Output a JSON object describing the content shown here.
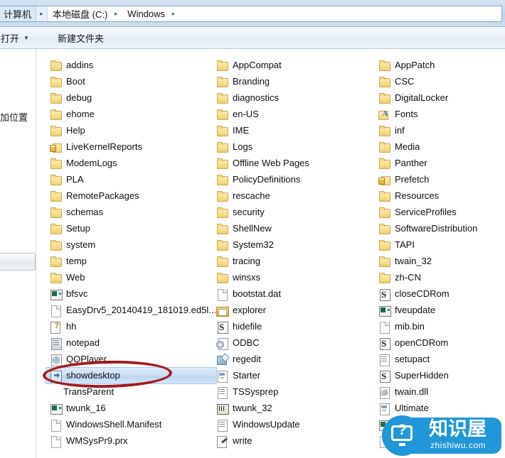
{
  "window": {
    "title": "Windows",
    "breadcrumb": {
      "root": "计算机",
      "items": [
        "本地磁盘 (C:)",
        "Windows"
      ],
      "separator": "▸",
      "root_arrow": "▸"
    }
  },
  "toolbar": {
    "open_label": "打开",
    "open_caret": "▼",
    "new_folder_label": "新建文件夹"
  },
  "nav_pane": {
    "clipped_label": "加位置"
  },
  "file_list": {
    "columns": [
      {
        "name": "column-1",
        "items": [
          {
            "label": "addins",
            "icon": "folder"
          },
          {
            "label": "Boot",
            "icon": "folder"
          },
          {
            "label": "debug",
            "icon": "folder"
          },
          {
            "label": "ehome",
            "icon": "folder"
          },
          {
            "label": "Help",
            "icon": "folder"
          },
          {
            "label": "LiveKernelReports",
            "icon": "folder-lock"
          },
          {
            "label": "ModemLogs",
            "icon": "folder"
          },
          {
            "label": "PLA",
            "icon": "folder"
          },
          {
            "label": "RemotePackages",
            "icon": "folder"
          },
          {
            "label": "schemas",
            "icon": "folder"
          },
          {
            "label": "Setup",
            "icon": "folder"
          },
          {
            "label": "system",
            "icon": "folder"
          },
          {
            "label": "temp",
            "icon": "folder"
          },
          {
            "label": "Web",
            "icon": "folder"
          },
          {
            "label": "bfsvc",
            "icon": "exe"
          },
          {
            "label": "EasyDrv5_20140419_181019.ed5l...",
            "icon": "doc"
          },
          {
            "label": "hh",
            "icon": "help"
          },
          {
            "label": "notepad",
            "icon": "notepad"
          },
          {
            "label": "QQPlayer",
            "icon": "media"
          },
          {
            "label": "showdesktop",
            "icon": "showdesktop",
            "selected": true
          },
          {
            "label": "TransParent",
            "icon": "none"
          },
          {
            "label": "twunk_16",
            "icon": "exe"
          },
          {
            "label": "WindowsShell.Manifest",
            "icon": "doc"
          },
          {
            "label": "WMSysPr9.prx",
            "icon": "doc"
          }
        ]
      },
      {
        "name": "column-2",
        "items": [
          {
            "label": "AppCompat",
            "icon": "folder"
          },
          {
            "label": "Branding",
            "icon": "folder"
          },
          {
            "label": "diagnostics",
            "icon": "folder"
          },
          {
            "label": "en-US",
            "icon": "folder"
          },
          {
            "label": "IME",
            "icon": "folder"
          },
          {
            "label": "Logs",
            "icon": "folder"
          },
          {
            "label": "Offline Web Pages",
            "icon": "folder"
          },
          {
            "label": "PolicyDefinitions",
            "icon": "folder"
          },
          {
            "label": "rescache",
            "icon": "folder"
          },
          {
            "label": "security",
            "icon": "folder"
          },
          {
            "label": "ShellNew",
            "icon": "folder"
          },
          {
            "label": "System32",
            "icon": "folder"
          },
          {
            "label": "tracing",
            "icon": "folder"
          },
          {
            "label": "winsxs",
            "icon": "folder"
          },
          {
            "label": "bootstat.dat",
            "icon": "doc"
          },
          {
            "label": "explorer",
            "icon": "explorer"
          },
          {
            "label": "hidefile",
            "icon": "script"
          },
          {
            "label": "ODBC",
            "icon": "cfg"
          },
          {
            "label": "regedit",
            "icon": "reg"
          },
          {
            "label": "Starter",
            "icon": "ini"
          },
          {
            "label": "TSSysprep",
            "icon": "text"
          },
          {
            "label": "twunk_32",
            "icon": "app"
          },
          {
            "label": "WindowsUpdate",
            "icon": "text"
          },
          {
            "label": "write",
            "icon": "write"
          }
        ]
      },
      {
        "name": "column-3",
        "items": [
          {
            "label": "AppPatch",
            "icon": "folder"
          },
          {
            "label": "CSC",
            "icon": "folder"
          },
          {
            "label": "DigitalLocker",
            "icon": "folder"
          },
          {
            "label": "Fonts",
            "icon": "folder-a"
          },
          {
            "label": "inf",
            "icon": "folder"
          },
          {
            "label": "Media",
            "icon": "folder"
          },
          {
            "label": "Panther",
            "icon": "folder"
          },
          {
            "label": "Prefetch",
            "icon": "folder-lock"
          },
          {
            "label": "Resources",
            "icon": "folder"
          },
          {
            "label": "ServiceProfiles",
            "icon": "folder"
          },
          {
            "label": "SoftwareDistribution",
            "icon": "folder"
          },
          {
            "label": "TAPI",
            "icon": "folder"
          },
          {
            "label": "twain_32",
            "icon": "folder"
          },
          {
            "label": "zh-CN",
            "icon": "folder"
          },
          {
            "label": "closeCDRom",
            "icon": "script"
          },
          {
            "label": "fveupdate",
            "icon": "exe"
          },
          {
            "label": "mib.bin",
            "icon": "doc"
          },
          {
            "label": "openCDRom",
            "icon": "script"
          },
          {
            "label": "setupact",
            "icon": "text"
          },
          {
            "label": "SuperHidden",
            "icon": "script"
          },
          {
            "label": "twain.dll",
            "icon": "dll"
          },
          {
            "label": "Ultimate",
            "icon": "ini"
          },
          {
            "label": "",
            "icon": "exe"
          },
          {
            "label": "",
            "icon": "doc"
          }
        ]
      }
    ]
  },
  "annotation": {
    "type": "ellipse",
    "target": "showdesktop",
    "color": "#a51a1f"
  },
  "watermark": {
    "brand_cn": "知识屋",
    "url": "zhishiwu.com",
    "question_mark": "?",
    "color": "#2196d8"
  },
  "colors": {
    "selection": "#cbdff6",
    "folder": "#f6dd8d",
    "chrome": "#c5d8ed"
  }
}
